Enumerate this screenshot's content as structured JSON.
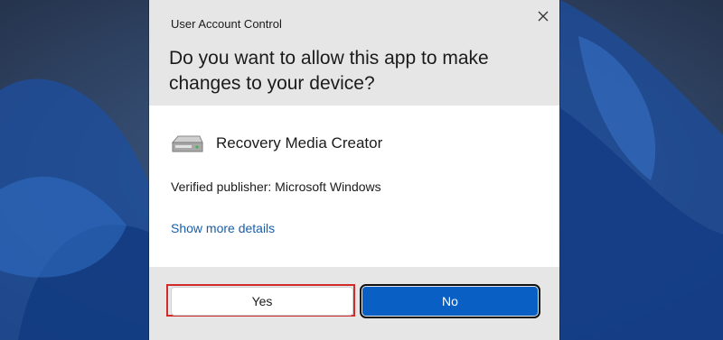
{
  "dialog": {
    "window_title": "User Account Control",
    "question": "Do you want to allow this app to make changes to your device?",
    "app_name": "Recovery Media Creator",
    "publisher": "Verified publisher: Microsoft Windows",
    "details_link": "Show more details",
    "yes_label": "Yes",
    "no_label": "No",
    "close_icon": "close-icon",
    "app_icon": "drive-icon"
  },
  "colors": {
    "header_bg": "#e6e6e6",
    "link": "#1a5ea8",
    "primary_button": "#0a5fc4",
    "highlight": "#d22a2a"
  }
}
